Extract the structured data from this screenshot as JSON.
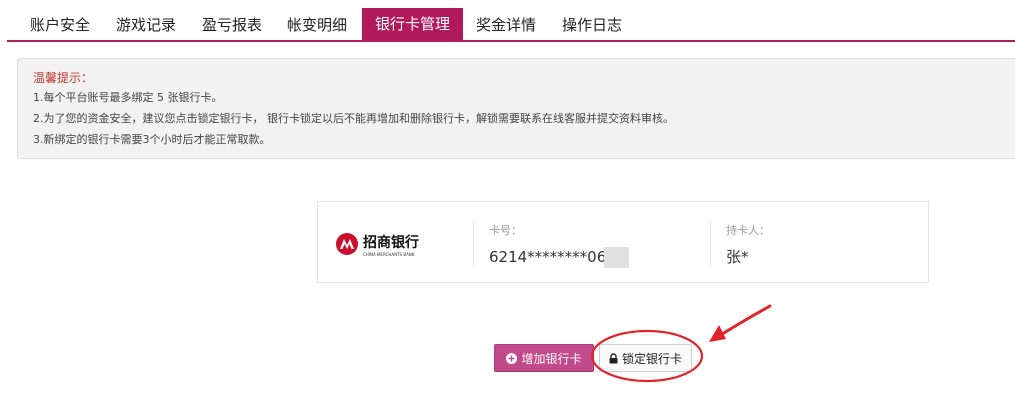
{
  "tabs": [
    {
      "label": "账户安全"
    },
    {
      "label": "游戏记录"
    },
    {
      "label": "盈亏报表"
    },
    {
      "label": "帐变明细"
    },
    {
      "label": "银行卡管理"
    },
    {
      "label": "奖金详情"
    },
    {
      "label": "操作日志"
    }
  ],
  "active_tab": "银行卡管理",
  "notice": {
    "title": "温馨提示：",
    "lines": [
      "1.每个平台账号最多绑定 5 张银行卡。",
      "2.为了您的资金安全，建议您点击锁定银行卡， 银行卡锁定以后不能再增加和删除银行卡，解锁需要联系在线客服并提交资料审核。",
      "3.新绑定的银行卡需要3个小时后才能正常取款。"
    ]
  },
  "card": {
    "bank_name_cn": "招商银行",
    "bank_name_en": "CHINA MERCHANTS BANK",
    "card_no_label": "卡号：",
    "card_no": "6214********06",
    "holder_label": "持卡人：",
    "holder": "张*"
  },
  "buttons": {
    "add_label": "增加银行卡",
    "lock_label": "锁定银行卡"
  },
  "colors": {
    "accent": "#b0195a",
    "add_button": "#c04a8a",
    "annotation": "#e0242b",
    "notice_title": "#c0392b"
  }
}
